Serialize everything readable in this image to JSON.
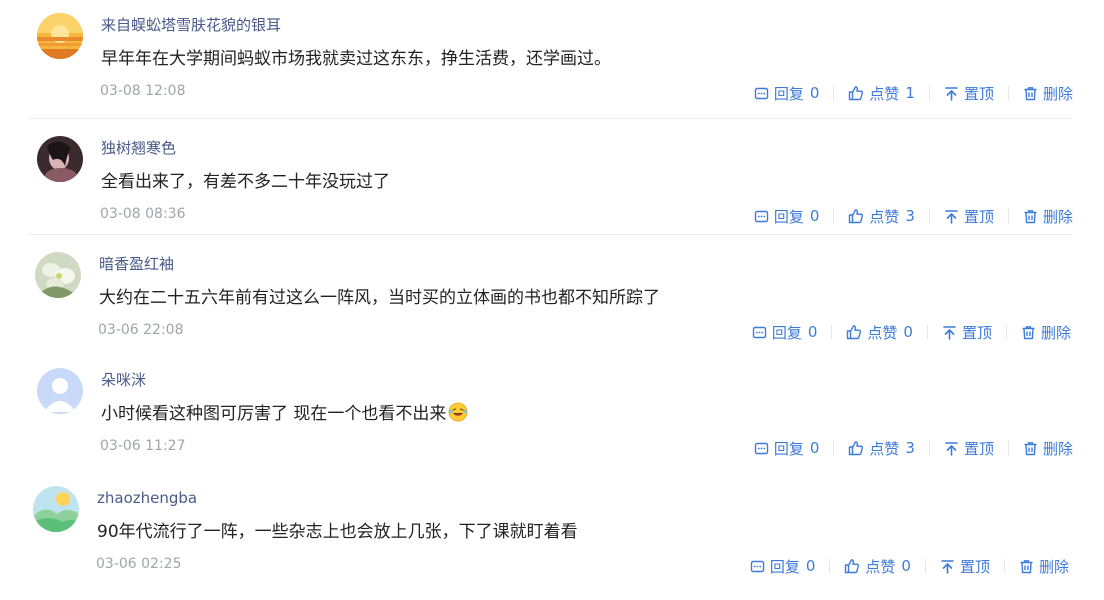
{
  "comments": [
    {
      "username": "来自蜈蚣塔雪肤花貌的银耳",
      "content": "早年年在大学期间蚂蚁市场我就卖过这东东，挣生活费，还学画过。",
      "time": "03-08 12:08",
      "reply_label": "回复",
      "reply_count": "0",
      "like_label": "点赞",
      "like_count": "1",
      "pin_label": "置顶",
      "delete_label": "删除"
    },
    {
      "username": "独树翘寒色",
      "content": "全看出来了，有差不多二十年没玩过了",
      "time": "03-08 08:36",
      "reply_label": "回复",
      "reply_count": "0",
      "like_label": "点赞",
      "like_count": "3",
      "pin_label": "置顶",
      "delete_label": "删除"
    },
    {
      "username": "暗香盈红袖",
      "content": "大约在二十五六年前有过这么一阵风，当时买的立体画的书也都不知所踪了",
      "time": "03-06 22:08",
      "reply_label": "回复",
      "reply_count": "0",
      "like_label": "点赞",
      "like_count": "0",
      "pin_label": "置顶",
      "delete_label": "删除"
    },
    {
      "username": "朵咪洣",
      "content": "小时候看这种图可厉害了 现在一个也看不出来",
      "time": "03-06 11:27",
      "reply_label": "回复",
      "reply_count": "0",
      "like_label": "点赞",
      "like_count": "3",
      "pin_label": "置顶",
      "delete_label": "删除"
    },
    {
      "username": "zhaozhengba",
      "content": "90年代流行了一阵，一些杂志上也会放上几张，下了课就盯着看",
      "time": "03-06 02:25",
      "reply_label": "回复",
      "reply_count": "0",
      "like_label": "点赞",
      "like_count": "0",
      "pin_label": "置顶",
      "delete_label": "删除"
    }
  ],
  "colors": {
    "link": "#3d7bd9",
    "username": "#4a5a8a",
    "content": "#222222",
    "time": "#a0a4ab",
    "divider": "#eceff3"
  },
  "icons": {
    "reply": "reply-box-icon",
    "like": "thumbs-up-icon",
    "pin": "arrow-up-pin-icon",
    "delete": "trash-icon",
    "emoji": "laughing-tears-emoji"
  }
}
